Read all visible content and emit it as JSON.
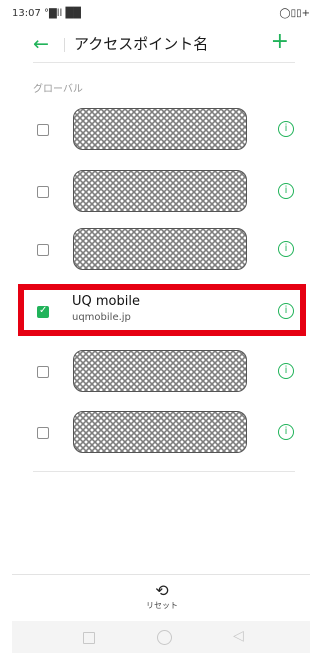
{
  "status_bar": {
    "time": "13:07",
    "signal": "°▇ll ██",
    "right_icons": "◯▯▯+"
  },
  "header": {
    "back_icon": "arrow-left-icon",
    "title": "アクセスポイント名",
    "add_icon": "plus-icon"
  },
  "section_label": "グローバル",
  "apns": [
    {
      "checked": false,
      "name": "",
      "detail": "",
      "redacted": true
    },
    {
      "checked": false,
      "name": "",
      "detail": "",
      "redacted": true
    },
    {
      "checked": false,
      "name": "",
      "detail": "",
      "redacted": true
    },
    {
      "checked": true,
      "name": "UQ mobile",
      "detail": "uqmobile.jp",
      "redacted": false
    },
    {
      "checked": false,
      "name": "",
      "detail": "",
      "redacted": true
    },
    {
      "checked": false,
      "name": "",
      "detail": "",
      "redacted": true
    }
  ],
  "footer": {
    "reset_label": "リセット",
    "reset_icon": "refresh-icon"
  },
  "colors": {
    "accent": "#21b35a",
    "highlight": "#e60012"
  },
  "nav_icons": [
    "square-icon",
    "circle-icon",
    "triangle-back-icon"
  ]
}
